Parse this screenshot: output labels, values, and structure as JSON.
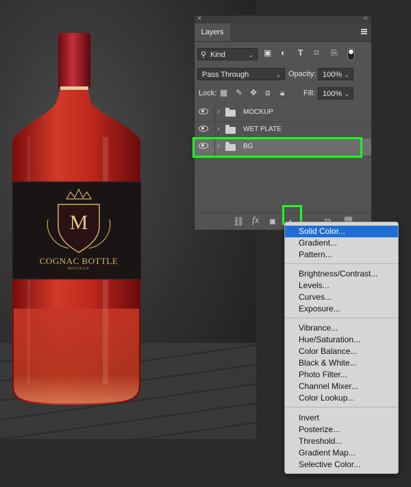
{
  "canvas": {
    "brand_text": "COGNAC BOTTLE",
    "sub_text": "MOCKUP",
    "monogram": "M"
  },
  "panel": {
    "close_glyph": "×",
    "collapse_glyph": "‹‹",
    "tab_label": "Layers",
    "filter": {
      "icon": "search-icon",
      "value": "Kind",
      "caret": "⌄"
    },
    "blend_mode": "Pass Through",
    "opacity_label": "Opacity:",
    "opacity_value": "100%",
    "lock_label": "Lock:",
    "fill_label": "Fill:",
    "fill_value": "100%",
    "layers": [
      {
        "name": "MOCKUP",
        "selected": false
      },
      {
        "name": "WET PLATE",
        "selected": false
      },
      {
        "name": "BG",
        "selected": true
      }
    ],
    "bottom_icons": [
      "link-icon",
      "fx-icon",
      "mask-icon",
      "adjustment-layer-icon",
      "group-icon",
      "new-layer-icon",
      "trash-icon"
    ],
    "fx_label": "fx"
  },
  "menu": {
    "groups": [
      [
        "Solid Color...",
        "Gradient...",
        "Pattern..."
      ],
      [
        "Brightness/Contrast...",
        "Levels...",
        "Curves...",
        "Exposure..."
      ],
      [
        "Vibrance...",
        "Hue/Saturation...",
        "Color Balance...",
        "Black & White...",
        "Photo Filter...",
        "Channel Mixer...",
        "Color Lookup..."
      ],
      [
        "Invert",
        "Posterize...",
        "Threshold...",
        "Gradient Map...",
        "Selective Color..."
      ]
    ],
    "active_item": "Solid Color..."
  },
  "colors": {
    "highlight": "#1aff1a",
    "menu_active": "#1f6ed6",
    "panel_bg": "#535353"
  }
}
